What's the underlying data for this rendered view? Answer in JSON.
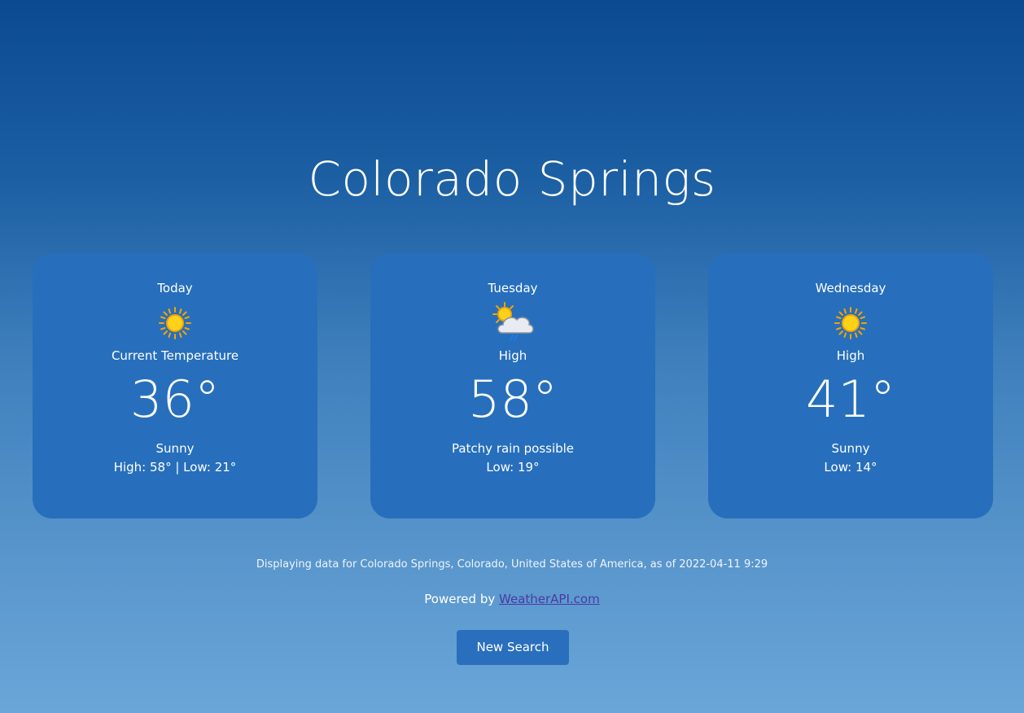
{
  "city": "Colorado Springs",
  "cards": [
    {
      "day": "Today",
      "icon": "sunny-icon",
      "temp_label": "Current Temperature",
      "temp": "36°",
      "condition": "Sunny",
      "range": "High: 58° | Low: 21°"
    },
    {
      "day": "Tuesday",
      "icon": "partly-cloudy-rain-icon",
      "temp_label": "High",
      "temp": "58°",
      "condition": "Patchy rain possible",
      "range": "Low: 19°"
    },
    {
      "day": "Wednesday",
      "icon": "sunny-icon",
      "temp_label": "High",
      "temp": "41°",
      "condition": "Sunny",
      "range": "Low: 14°"
    }
  ],
  "footer": {
    "note": "Displaying data for Colorado Springs, Colorado, United States of America, as of 2022-04-11 9:29",
    "powered_prefix": "Powered by ",
    "powered_link": "WeatherAPI.com"
  },
  "button": {
    "new_search": "New Search"
  },
  "colors": {
    "card": "#276fbc",
    "button": "#2a6fbd",
    "link": "#4b39a6",
    "sun": "#ffd21a"
  }
}
